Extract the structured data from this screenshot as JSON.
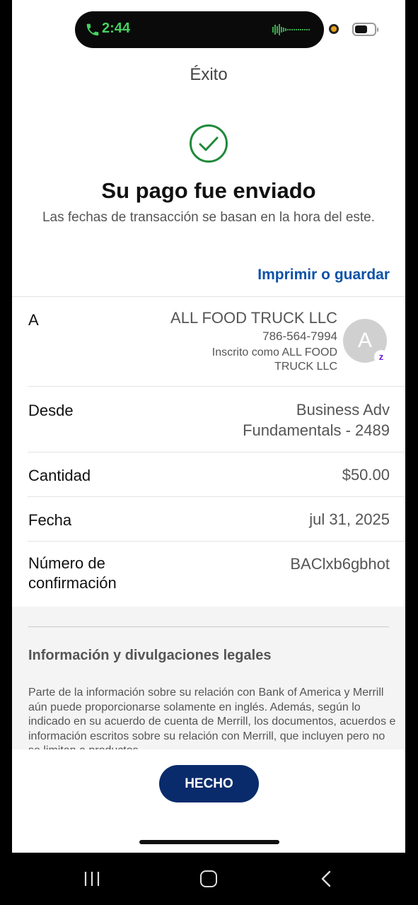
{
  "status_bar": {
    "call_time": "2:44"
  },
  "header": {
    "title": "Éxito"
  },
  "confirmation": {
    "headline": "Su pago fue enviado",
    "subheadline": "Las fechas de transacción se basan en la hora del este.",
    "print_link": "Imprimir o guardar"
  },
  "details": {
    "to": {
      "label": "A",
      "name": "ALL FOOD TRUCK LLC",
      "phone": "786-564-7994",
      "enrolled_line1": "Inscrito como ALL FOOD",
      "enrolled_line2": "TRUCK LLC",
      "avatar_initial": "A",
      "badge": "z"
    },
    "from": {
      "label": "Desde",
      "value_line1": "Business Adv",
      "value_line2": "Fundamentals - 2489"
    },
    "amount": {
      "label": "Cantidad",
      "value": "$50.00"
    },
    "date": {
      "label": "Fecha",
      "value": "jul 31, 2025"
    },
    "confirmation_number": {
      "label_line1": "Número de",
      "label_line2": "confirmación",
      "value": "BAClxb6gbhot"
    }
  },
  "legal": {
    "title": "Información y divulgaciones legales",
    "body": "Parte de la información sobre su relación con Bank of America y Merrill aún puede proporcionarse solamente en inglés. Además, según lo indicado en su acuerdo de cuenta de Merrill, los documentos, acuerdos e información escritos sobre su relación con Merrill, que incluyen pero no se limitan a productos"
  },
  "actions": {
    "done_label": "HECHO"
  },
  "colors": {
    "link": "#0b52a7",
    "button": "#0a2b6b",
    "success": "#1f8a3a",
    "call_green": "#46d160"
  }
}
